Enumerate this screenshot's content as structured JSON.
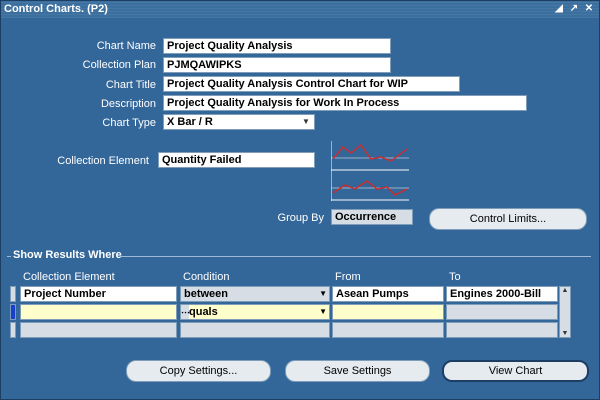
{
  "window": {
    "title": "Control Charts. (P2)",
    "controls": [
      "minimize-icon",
      "restore-icon",
      "close-icon"
    ]
  },
  "form": {
    "chart_name": {
      "label": "Chart Name",
      "value": "Project Quality Analysis"
    },
    "collection_plan": {
      "label": "Collection Plan",
      "value": "PJMQAWIPKS"
    },
    "chart_title": {
      "label": "Chart Title",
      "value": "Project Quality Analysis Control Chart for WIP"
    },
    "description": {
      "label": "Description",
      "value": "Project Quality Analysis for Work In Process"
    },
    "chart_type": {
      "label": "Chart Type",
      "value": "X Bar / R"
    },
    "collection_element": {
      "label": "Collection Element",
      "value": "Quantity Failed"
    },
    "group_by": {
      "label": "Group By",
      "value": "Occurrence"
    }
  },
  "buttons": {
    "control_limits": "Control Limits...",
    "copy_settings": "Copy Settings...",
    "save_settings": "Save Settings",
    "view_chart": "View Chart"
  },
  "results": {
    "title": "Show Results Where",
    "columns": [
      "Collection Element",
      "Condition",
      "From",
      "To"
    ],
    "rows": [
      {
        "element": "Project Number",
        "condition": "between",
        "from": "Asean Pumps",
        "to": "Engines 2000-Bill"
      },
      {
        "element": "",
        "condition": "Equals",
        "condition_display": "quals",
        "from": "",
        "to": ""
      },
      {
        "element": "",
        "condition": "",
        "from": "",
        "to": ""
      }
    ]
  },
  "colors": {
    "background": "#336699",
    "titlebar": "#3b6f9e",
    "active_row": "#ffffcc",
    "chart_line": "#d12a2a"
  }
}
